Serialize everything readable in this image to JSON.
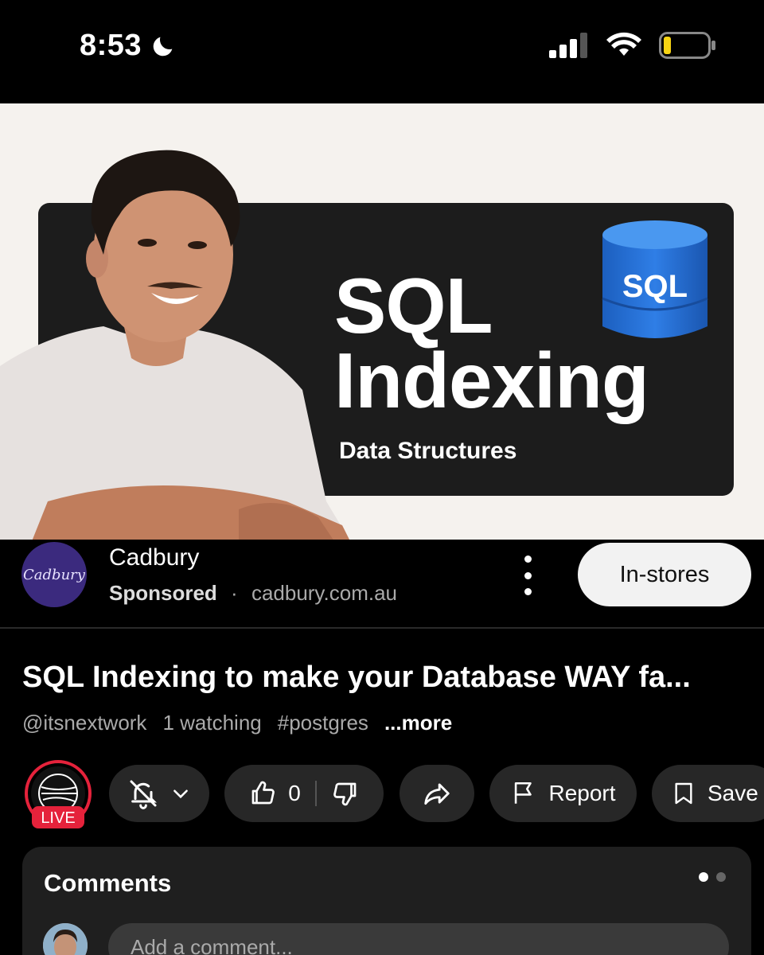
{
  "status_bar": {
    "time": "8:53",
    "icons": [
      "moon-icon",
      "signal-icon",
      "wifi-icon",
      "battery-icon"
    ]
  },
  "thumbnail": {
    "title_line1": "SQL",
    "title_line2": "Indexing",
    "subtitle": "Data Structures",
    "db_badge": "SQL"
  },
  "ad": {
    "logo_text": "Cadbury",
    "name": "Cadbury",
    "sponsored": "Sponsored",
    "separator": "·",
    "url": "cadbury.com.au",
    "cta": "In-stores"
  },
  "video": {
    "title": "SQL Indexing to make your Database WAY fa...",
    "channel": "@itsnextwork",
    "watching": "1 watching",
    "hashtag": "#postgres",
    "more": "...more"
  },
  "actions": {
    "live_badge": "LIVE",
    "like_count": "0",
    "report_label": "Report",
    "save_label": "Save"
  },
  "comments": {
    "title": "Comments",
    "placeholder": "Add a comment..."
  },
  "colors": {
    "live": "#e5223b",
    "accent_cta_bg": "#f2f2f2",
    "pill_bg": "#272727"
  }
}
